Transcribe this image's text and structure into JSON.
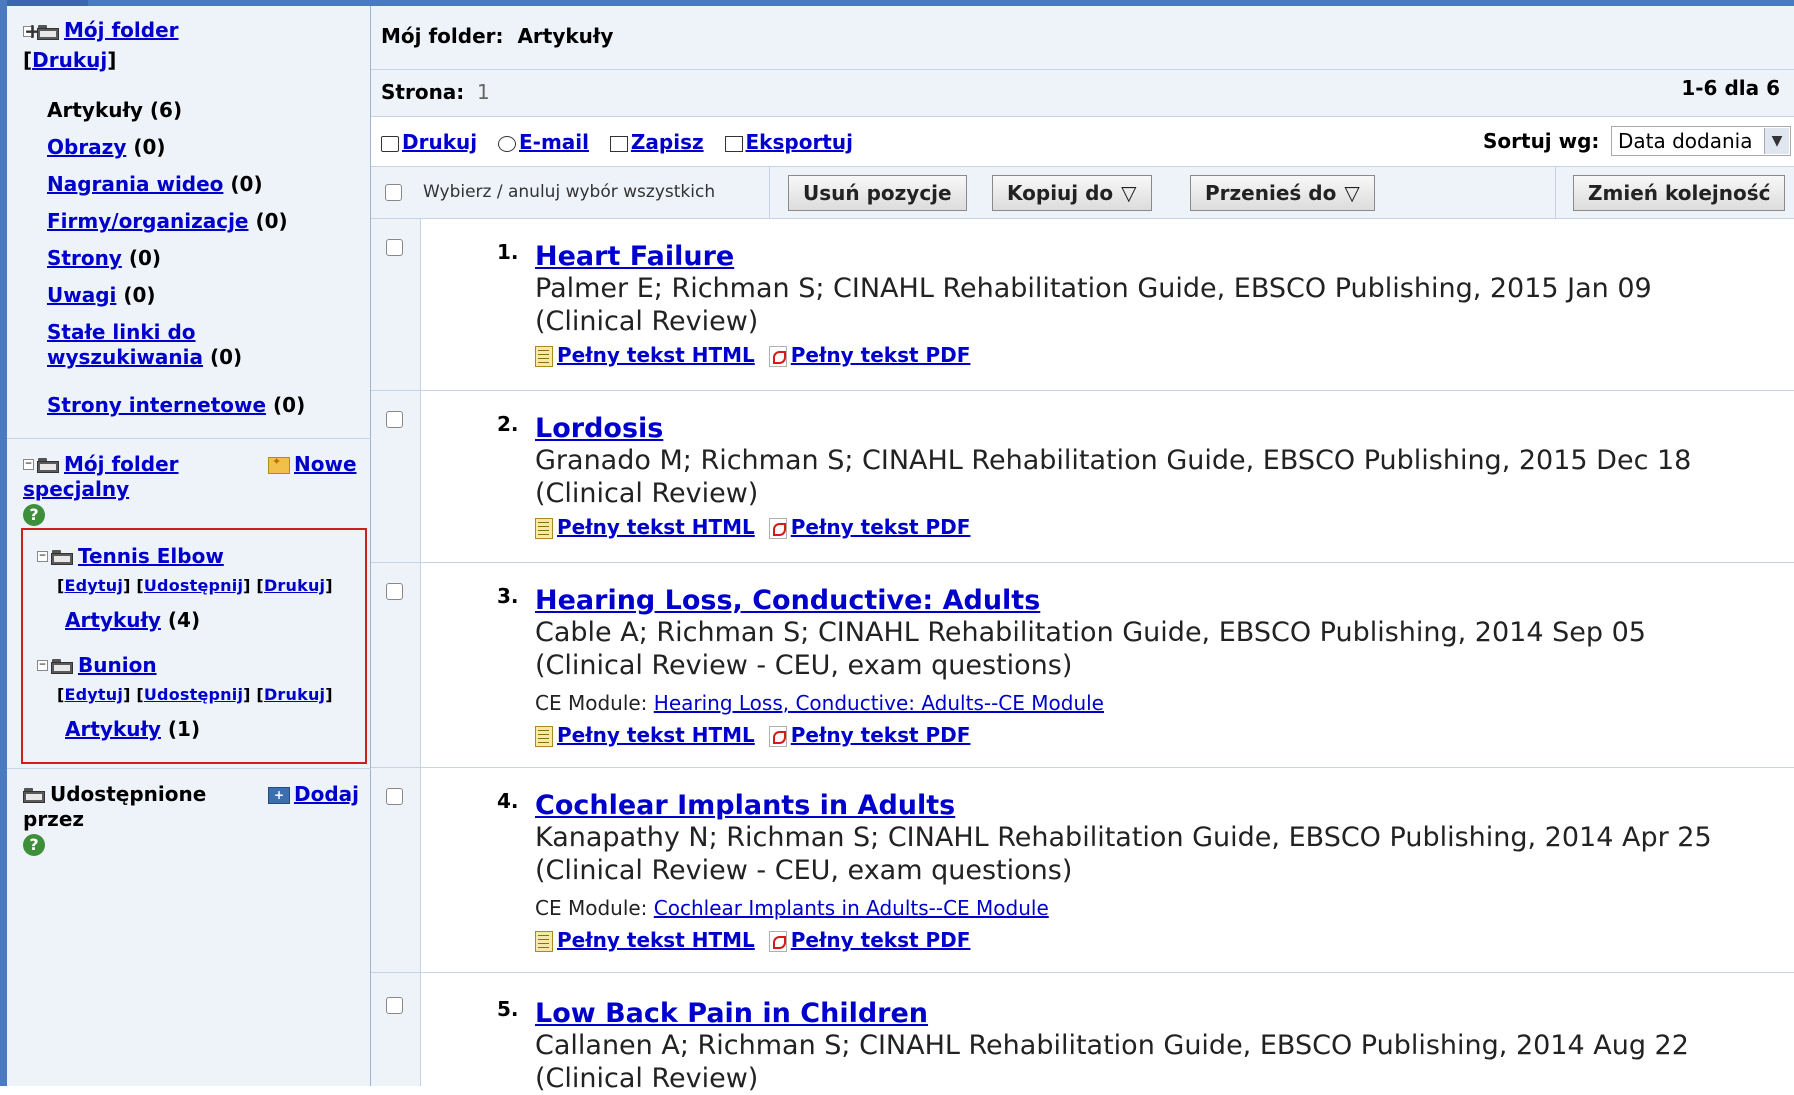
{
  "sidebar": {
    "my_folder": {
      "title": "Mój folder",
      "print_prefix": "[",
      "print": "Drukuj",
      "print_suffix": "]",
      "items": [
        {
          "label": "Artykuły",
          "count": "(6)",
          "link": false
        },
        {
          "label": "Obrazy",
          "count": "(0)",
          "link": true
        },
        {
          "label": "Nagrania wideo",
          "count": "(0)",
          "link": true
        },
        {
          "label": "Firmy/organizacje",
          "count": "(0)",
          "link": true
        },
        {
          "label": "Strony",
          "count": "(0)",
          "link": true
        },
        {
          "label": "Uwagi",
          "count": "(0)",
          "link": true
        },
        {
          "label": "Stałe linki do",
          "label2": "wyszukiwania",
          "count": "(0)",
          "link": true
        },
        {
          "label": "Strony internetowe",
          "count": "(0)",
          "link": true
        }
      ]
    },
    "special_folder": {
      "title": "Mój folder",
      "title2": "specjalny",
      "new_label": "Nowe",
      "help": "?"
    },
    "custom_folders": [
      {
        "name": "Tennis Elbow",
        "edit": "Edytuj",
        "share": "Udostępnij",
        "print": "Drukuj",
        "articles": "Artykuły",
        "count": "(4)"
      },
      {
        "name": "Bunion",
        "edit": "Edytuj",
        "share": "Udostępnij",
        "print": "Drukuj",
        "articles": "Artykuły",
        "count": "(1)"
      }
    ],
    "shared": {
      "title": "Udostępnione",
      "title2": "przez",
      "add_label": "Dodaj",
      "help": "?"
    }
  },
  "main": {
    "header": {
      "label": "Mój folder:",
      "value": "Artykuły"
    },
    "page": {
      "label": "Strona:",
      "value": "1",
      "range": "1-6 dla 6"
    },
    "actions": {
      "print": "Drukuj",
      "email": "E-mail",
      "save": "Zapisz",
      "export": "Eksportuj"
    },
    "sort": {
      "label": "Sortuj wg:",
      "value": "Data dodania"
    },
    "tools": {
      "select_all": "Wybierz / anuluj wybór wszystkich",
      "delete": "Usuń pozycje",
      "copy": "Kopiuj do",
      "move": "Przenieś do",
      "reorder": "Zmień kolejność"
    },
    "results": [
      {
        "num": "1.",
        "title": "Heart Failure",
        "meta1": "Palmer E; Richman S; CINAHL Rehabilitation Guide, EBSCO Publishing, 2015 Jan 09",
        "meta2": "(Clinical Review)",
        "ce_label": "",
        "ce_link": "",
        "html": "Pełny tekst HTML",
        "pdf": "Pełny tekst PDF"
      },
      {
        "num": "2.",
        "title": "Lordosis",
        "meta1": "Granado M; Richman S; CINAHL Rehabilitation Guide, EBSCO Publishing, 2015 Dec 18",
        "meta2": "(Clinical Review)",
        "ce_label": "",
        "ce_link": "",
        "html": "Pełny tekst HTML",
        "pdf": "Pełny tekst PDF"
      },
      {
        "num": "3.",
        "title": "Hearing Loss, Conductive: Adults",
        "meta1": "Cable A; Richman S; CINAHL Rehabilitation Guide, EBSCO Publishing, 2014 Sep 05",
        "meta2": "(Clinical Review - CEU, exam questions)",
        "ce_label": "CE Module:",
        "ce_link": "Hearing Loss, Conductive: Adults--CE Module",
        "html": "Pełny tekst HTML",
        "pdf": "Pełny tekst PDF"
      },
      {
        "num": "4.",
        "title": "Cochlear Implants in Adults",
        "meta1": "Kanapathy N; Richman S; CINAHL Rehabilitation Guide, EBSCO Publishing, 2014 Apr 25",
        "meta2": "(Clinical Review - CEU, exam questions)",
        "ce_label": "CE Module:",
        "ce_link": "Cochlear Implants in Adults--CE Module",
        "html": "Pełny tekst HTML",
        "pdf": "Pełny tekst PDF"
      },
      {
        "num": "5.",
        "title": "Low Back Pain in Children",
        "meta1": "Callanen A; Richman S; CINAHL Rehabilitation Guide, EBSCO Publishing, 2014 Aug 22",
        "meta2": "(Clinical Review)",
        "ce_label": "",
        "ce_link": "",
        "html": "",
        "pdf": ""
      }
    ]
  },
  "colors": {
    "accent": "#4a7bbf",
    "link": "#0000cc",
    "panel": "#eef3fa",
    "highlight_border": "#cc1f1f"
  }
}
